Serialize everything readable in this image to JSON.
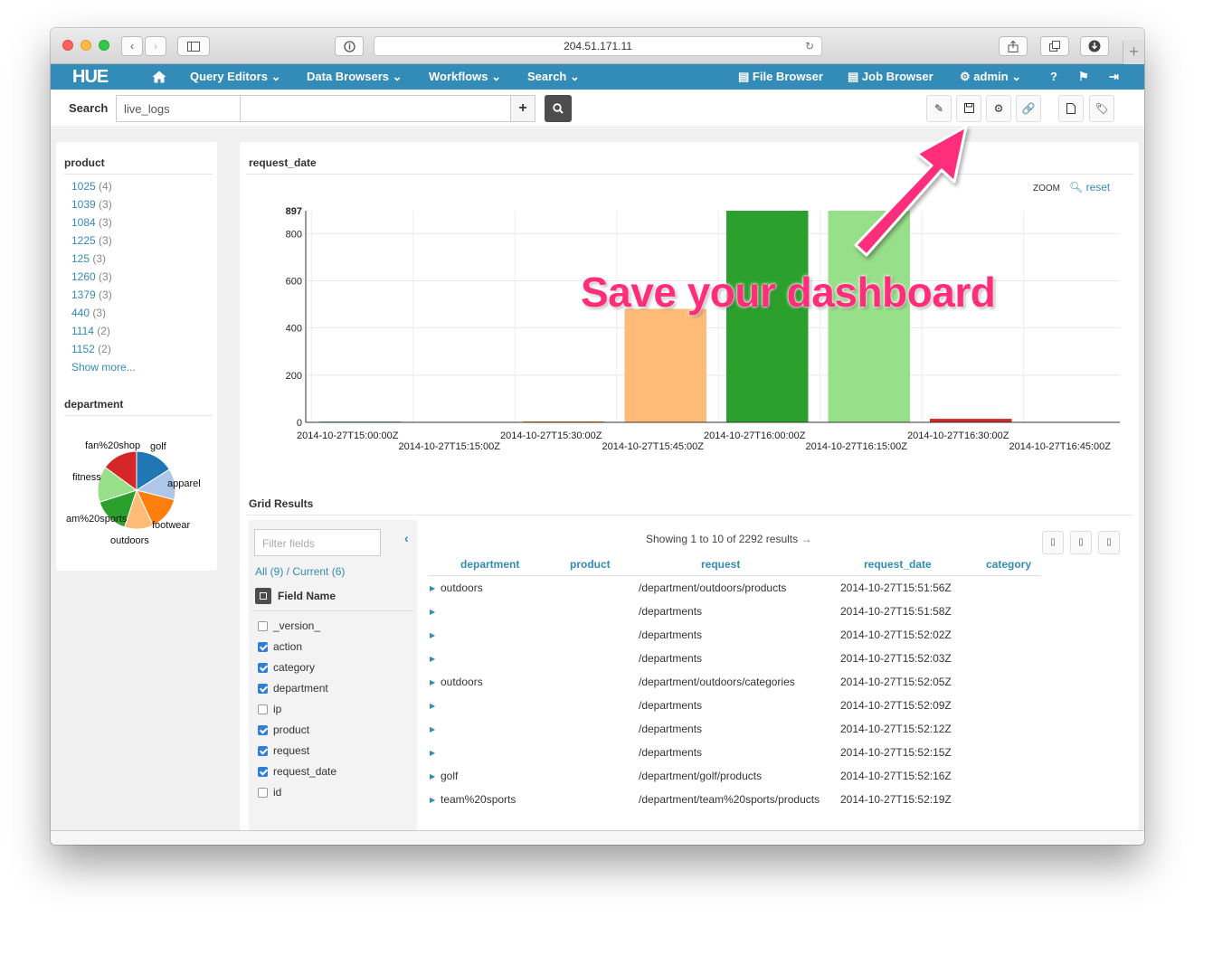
{
  "browser": {
    "url": "204.51.171.11",
    "reload_icon": "reload-icon"
  },
  "navbar": {
    "logo": "HUE",
    "home_icon": "home-icon",
    "items": [
      "Query Editors",
      "Data Browsers",
      "Workflows",
      "Search"
    ],
    "right_items": [
      "File Browser",
      "Job Browser",
      "admin"
    ],
    "color": "#338bb8"
  },
  "search": {
    "label": "Search",
    "collection": "live_logs",
    "query": "",
    "toolbar_icons": [
      "pencil-icon",
      "save-icon",
      "gear-icon",
      "link-icon",
      "document-icon",
      "tags-icon"
    ]
  },
  "sidebar": {
    "product": {
      "title": "product",
      "items": [
        {
          "value": "1025",
          "count": "(4)"
        },
        {
          "value": "1039",
          "count": "(3)"
        },
        {
          "value": "1084",
          "count": "(3)"
        },
        {
          "value": "1225",
          "count": "(3)"
        },
        {
          "value": "125",
          "count": "(3)"
        },
        {
          "value": "1260",
          "count": "(3)"
        },
        {
          "value": "1379",
          "count": "(3)"
        },
        {
          "value": "440",
          "count": "(3)"
        },
        {
          "value": "1114",
          "count": "(2)"
        },
        {
          "value": "1152",
          "count": "(2)"
        }
      ],
      "show_more": "Show more..."
    },
    "department": {
      "title": "department",
      "labels": [
        "fan%20shop",
        "golf",
        "apparel",
        "fitness",
        "am%20sports",
        "footwear",
        "outdoors"
      ]
    }
  },
  "chart_panel": {
    "title": "request_date",
    "zoom_label": "ZOOM",
    "reset_label": "reset"
  },
  "chart_data": [
    {
      "type": "bar",
      "title": "request_date",
      "categories": [
        "2014-10-27T15:00:00Z",
        "2014-10-27T15:15:00Z",
        "2014-10-27T15:30:00Z",
        "2014-10-27T15:45:00Z",
        "2014-10-27T16:00:00Z",
        "2014-10-27T16:15:00Z",
        "2014-10-27T16:30:00Z",
        "2014-10-27T16:45:00Z"
      ],
      "values": [
        3,
        2,
        4,
        481,
        897,
        897,
        15,
        2
      ],
      "colors": [
        "#1f77b4",
        "#aec7e8",
        "#ff7f0e",
        "#ffbb78",
        "#2ca02c",
        "#98df8a",
        "#d62728",
        "#ff9896"
      ],
      "y_ticks": [
        0,
        200,
        400,
        600,
        800,
        897
      ],
      "ylim": [
        0,
        897
      ],
      "grid": true
    },
    {
      "type": "pie",
      "title": "department",
      "categories": [
        "golf",
        "apparel",
        "footwear",
        "outdoors",
        "am%20sports",
        "fitness",
        "fan%20shop"
      ],
      "values": [
        16,
        13,
        14,
        12,
        15,
        15,
        15
      ],
      "colors": [
        "#1f77b4",
        "#aec7e8",
        "#ff7f0e",
        "#ffbb78",
        "#2ca02c",
        "#98df8a",
        "#d62728"
      ]
    }
  ],
  "grid": {
    "title": "Grid Results",
    "filter_placeholder": "Filter fields",
    "all_label": "All (9)",
    "current_label": "Current (6)",
    "field_name_header": "Field Name",
    "fields": [
      {
        "name": "_version_",
        "checked": false
      },
      {
        "name": "action",
        "checked": true
      },
      {
        "name": "category",
        "checked": true
      },
      {
        "name": "department",
        "checked": true
      },
      {
        "name": "ip",
        "checked": false
      },
      {
        "name": "product",
        "checked": true
      },
      {
        "name": "request",
        "checked": true
      },
      {
        "name": "request_date",
        "checked": true
      },
      {
        "name": "id",
        "checked": false
      }
    ],
    "showing": "Showing 1 to 10 of 2292 results",
    "columns": [
      "department",
      "product",
      "request",
      "request_date",
      "category"
    ],
    "rows": [
      {
        "department": "outdoors",
        "product": "",
        "request": "/department/outdoors/products",
        "request_date": "2014-10-27T15:51:56Z",
        "category": ""
      },
      {
        "department": "",
        "product": "",
        "request": "/departments",
        "request_date": "2014-10-27T15:51:58Z",
        "category": ""
      },
      {
        "department": "",
        "product": "",
        "request": "/departments",
        "request_date": "2014-10-27T15:52:02Z",
        "category": ""
      },
      {
        "department": "",
        "product": "",
        "request": "/departments",
        "request_date": "2014-10-27T15:52:03Z",
        "category": ""
      },
      {
        "department": "outdoors",
        "product": "",
        "request": "/department/outdoors/categories",
        "request_date": "2014-10-27T15:52:05Z",
        "category": ""
      },
      {
        "department": "",
        "product": "",
        "request": "/departments",
        "request_date": "2014-10-27T15:52:09Z",
        "category": ""
      },
      {
        "department": "",
        "product": "",
        "request": "/departments",
        "request_date": "2014-10-27T15:52:12Z",
        "category": ""
      },
      {
        "department": "",
        "product": "",
        "request": "/departments",
        "request_date": "2014-10-27T15:52:15Z",
        "category": ""
      },
      {
        "department": "golf",
        "product": "",
        "request": "/department/golf/products",
        "request_date": "2014-10-27T15:52:16Z",
        "category": ""
      },
      {
        "department": "team%20sports",
        "product": "",
        "request": "/department/team%20sports/products",
        "request_date": "2014-10-27T15:52:19Z",
        "category": ""
      }
    ]
  },
  "callout": {
    "text": "Save your dashboard",
    "color": "#ff2e7b"
  }
}
